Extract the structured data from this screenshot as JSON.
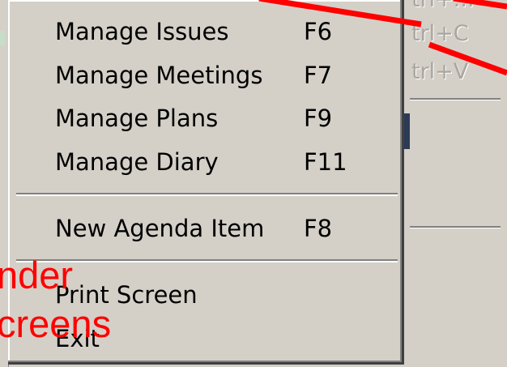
{
  "background_window": {
    "shortcut_copy_fragment": "trl+C",
    "shortcut_paste_fragment": "trl+V",
    "shortcut_top_fragment": "trl+..."
  },
  "menu": {
    "items": [
      {
        "label": "Manage Issues",
        "shortcut": "F6"
      },
      {
        "label": "Manage Meetings",
        "shortcut": "F7"
      },
      {
        "label": "Manage Plans",
        "shortcut": "F9"
      },
      {
        "label": "Manage Diary",
        "shortcut": "F11"
      },
      {
        "label": "New Agenda Item",
        "shortcut": "F8"
      },
      {
        "label": "Print Screen",
        "shortcut": ""
      },
      {
        "label": "Exit",
        "shortcut": ""
      }
    ]
  },
  "overlay": {
    "text_line_1": "nder",
    "text_line_2": "creens",
    "color": "#ff0000"
  }
}
